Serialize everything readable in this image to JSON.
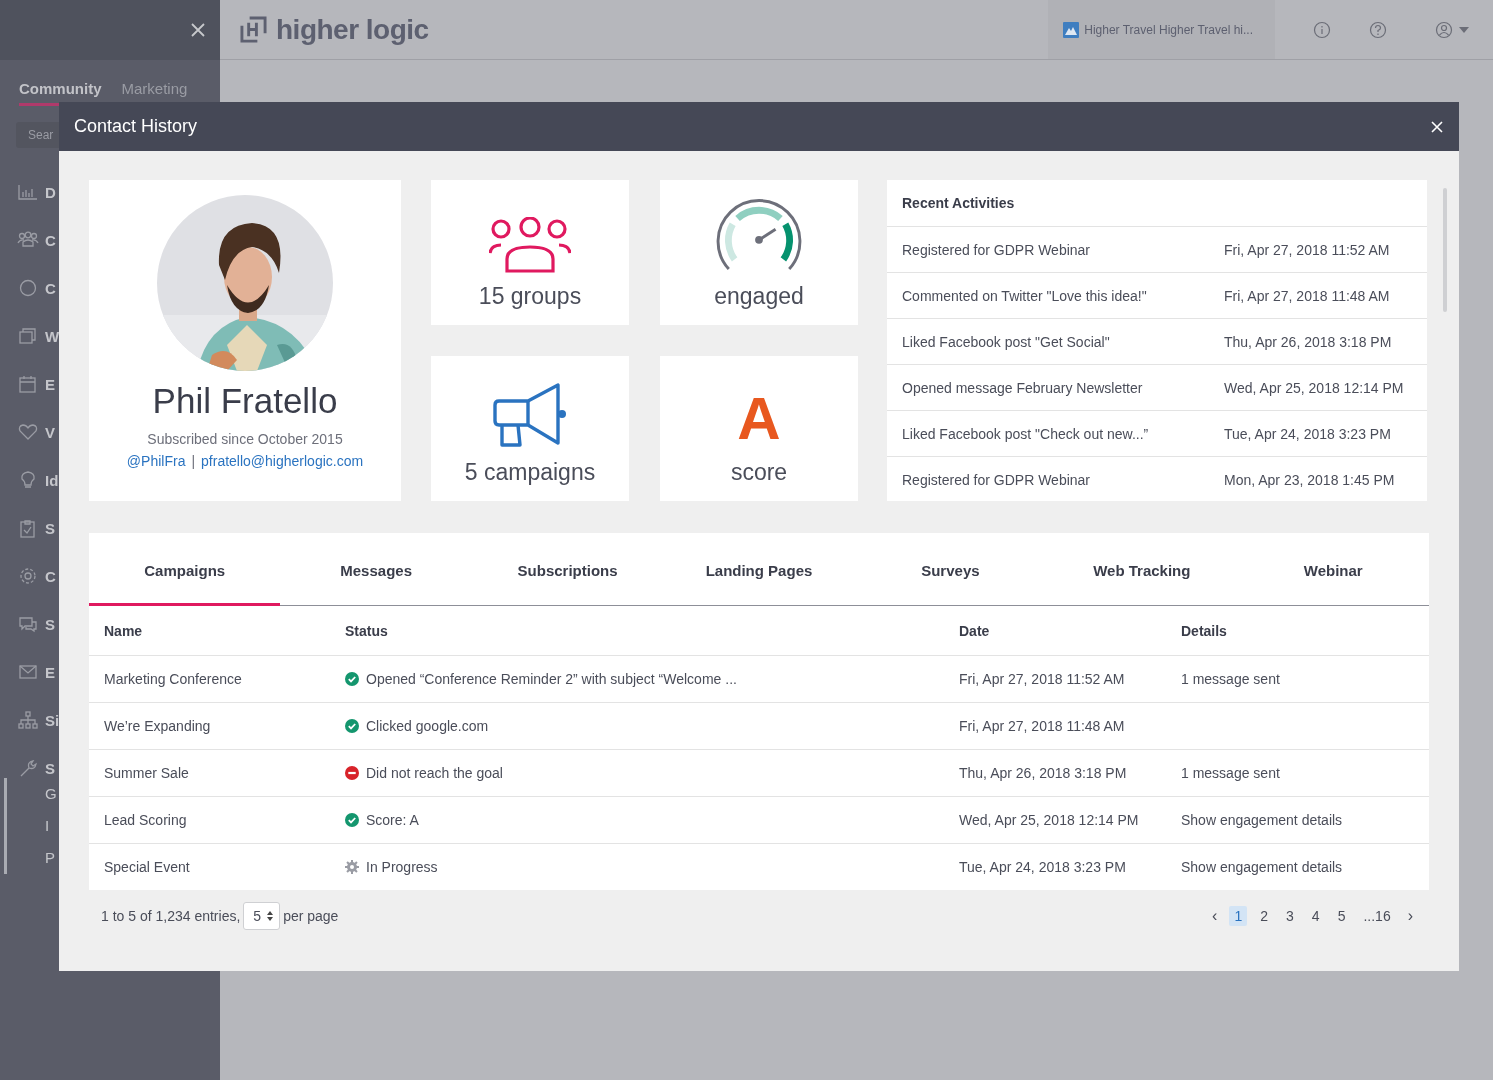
{
  "app": {
    "logo": "higher logic",
    "org": "Higher Travel Higher Travel hi...",
    "sidebar_tabs": [
      {
        "label": "Community",
        "selected": true
      },
      {
        "label": "Marketing",
        "selected": false
      }
    ],
    "search": {
      "placeholder": "Sear"
    },
    "sidebar_items": [
      {
        "kind": "chart",
        "label": "D"
      },
      {
        "kind": "people",
        "label": "C"
      },
      {
        "kind": "circle",
        "label": "C"
      },
      {
        "kind": "windows",
        "label": "W"
      },
      {
        "kind": "calendar",
        "label": "E"
      },
      {
        "kind": "heart",
        "label": "V"
      },
      {
        "kind": "bulb",
        "label": "Id"
      },
      {
        "kind": "clipboard",
        "label": "S"
      },
      {
        "kind": "gear",
        "label": "C"
      },
      {
        "kind": "chat",
        "label": "S"
      },
      {
        "kind": "mail",
        "label": "E"
      },
      {
        "kind": "sitemap",
        "label": "Si"
      },
      {
        "kind": "wrench",
        "label": "S",
        "children": [
          {
            "label": "G"
          },
          {
            "label": "I"
          },
          {
            "label": "P"
          }
        ]
      }
    ]
  },
  "modal": {
    "title": "Contact History",
    "profile": {
      "kind": "picture",
      "name": "Phil Fratello",
      "since": "Subscribed since October 2015",
      "handle": "@PhilFra",
      "separator": "|",
      "email": "pfratello@higherlogic.com"
    },
    "stat_rows": [
      {
        "cards": [
          {
            "kind": "groups",
            "label": "15 groups"
          },
          {
            "kind": "gauge",
            "label": "engaged"
          }
        ]
      },
      {
        "cards": [
          {
            "kind": "campaigns",
            "label": "5 campaigns"
          },
          {
            "kind": "grade",
            "grade": "A",
            "label": "score"
          }
        ]
      }
    ],
    "recent": {
      "title": "Recent Activities",
      "items": [
        {
          "text": "Registered for GDPR Webinar",
          "date": "Fri, Apr 27, 2018 11:52 AM"
        },
        {
          "text": "Commented on Twitter \"Love this idea!\"",
          "date": "Fri, Apr 27, 2018 11:48 AM"
        },
        {
          "text": "Liked Facebook post \"Get Social\"",
          "date": "Thu, Apr 26, 2018 3:18 PM"
        },
        {
          "text": "Opened message February Newsletter",
          "date": "Wed, Apr 25, 2018 12:14 PM"
        },
        {
          "text": "Liked Facebook post \"Check out new...”",
          "date": "Tue, Apr 24, 2018 3:23 PM"
        },
        {
          "text": "Registered for GDPR Webinar",
          "date": "Mon, Apr 23, 2018 1:45 PM"
        }
      ]
    },
    "tabs": [
      {
        "label": "Campaigns",
        "selected": true
      },
      {
        "label": "Messages",
        "selected": false
      },
      {
        "label": "Subscriptions",
        "selected": false
      },
      {
        "label": "Landing Pages",
        "selected": false
      },
      {
        "label": "Surveys",
        "selected": false
      },
      {
        "label": "Web Tracking",
        "selected": false
      },
      {
        "label": "Webinar",
        "selected": false
      }
    ],
    "table": {
      "columns": [
        "Name",
        "Status",
        "Date",
        "Details"
      ],
      "rows": [
        {
          "name": "Marketing Conference",
          "kind": "success",
          "status": "Opened “Conference Reminder 2” with subject “Welcome ...",
          "date": "Fri, Apr 27, 2018 11:52 AM",
          "details": "1 message sent"
        },
        {
          "name": "We’re Expanding",
          "kind": "success",
          "status": "Clicked google.com",
          "date": "Fri, Apr 27, 2018 11:48 AM"
        },
        {
          "name": "Summer Sale",
          "kind": "error",
          "status": "Did not reach the goal",
          "date": "Thu, Apr 26, 2018 3:18 PM",
          "details": "1 message sent"
        },
        {
          "name": "Lead Scoring",
          "kind": "success",
          "status": "Score: A",
          "date": "Wed, Apr 25, 2018 12:14 PM",
          "details": "Show engagement details"
        },
        {
          "name": "Special Event",
          "kind": "progress",
          "status": "In Progress",
          "date": "Tue, Apr 24, 2018 3:23 PM",
          "details": "Show engagement details"
        }
      ]
    },
    "footer": {
      "entries": "1 to 5 of 1,234 entries,",
      "per_page_value": "5",
      "per_page": "per page",
      "prev": "‹",
      "next": "›",
      "pages": [
        {
          "label": "1",
          "selected": true
        },
        {
          "label": "2",
          "selected": false
        },
        {
          "label": "3",
          "selected": false
        },
        {
          "label": "4",
          "selected": false
        },
        {
          "label": "5",
          "selected": false
        },
        {
          "label": "...16",
          "selected": false
        }
      ]
    }
  }
}
